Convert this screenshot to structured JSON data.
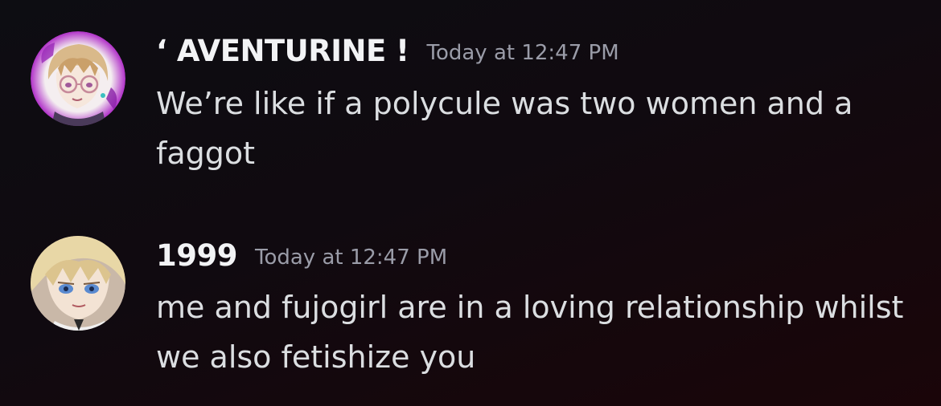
{
  "messages": [
    {
      "username": "‘ AVENTURINE !",
      "timestamp": "Today at 12:47 PM",
      "text": "We’re like if a polycule was two women and a faggot",
      "avatar_icon": "avatar-blonde-glasses"
    },
    {
      "username": "1999",
      "timestamp": "Today at 12:47 PM",
      "text": "me and fujogirl are in a loving relationship whilst we also fetishize you",
      "avatar_icon": "avatar-blonde-blue-eyes"
    }
  ],
  "colors": {
    "background_top": "#0d0d12",
    "background_bottom": "#1a0509",
    "username": "#f2f3f5",
    "timestamp": "#9a9ca8",
    "message_text": "#dbdee1",
    "avatar_glow": "#b030c8"
  }
}
